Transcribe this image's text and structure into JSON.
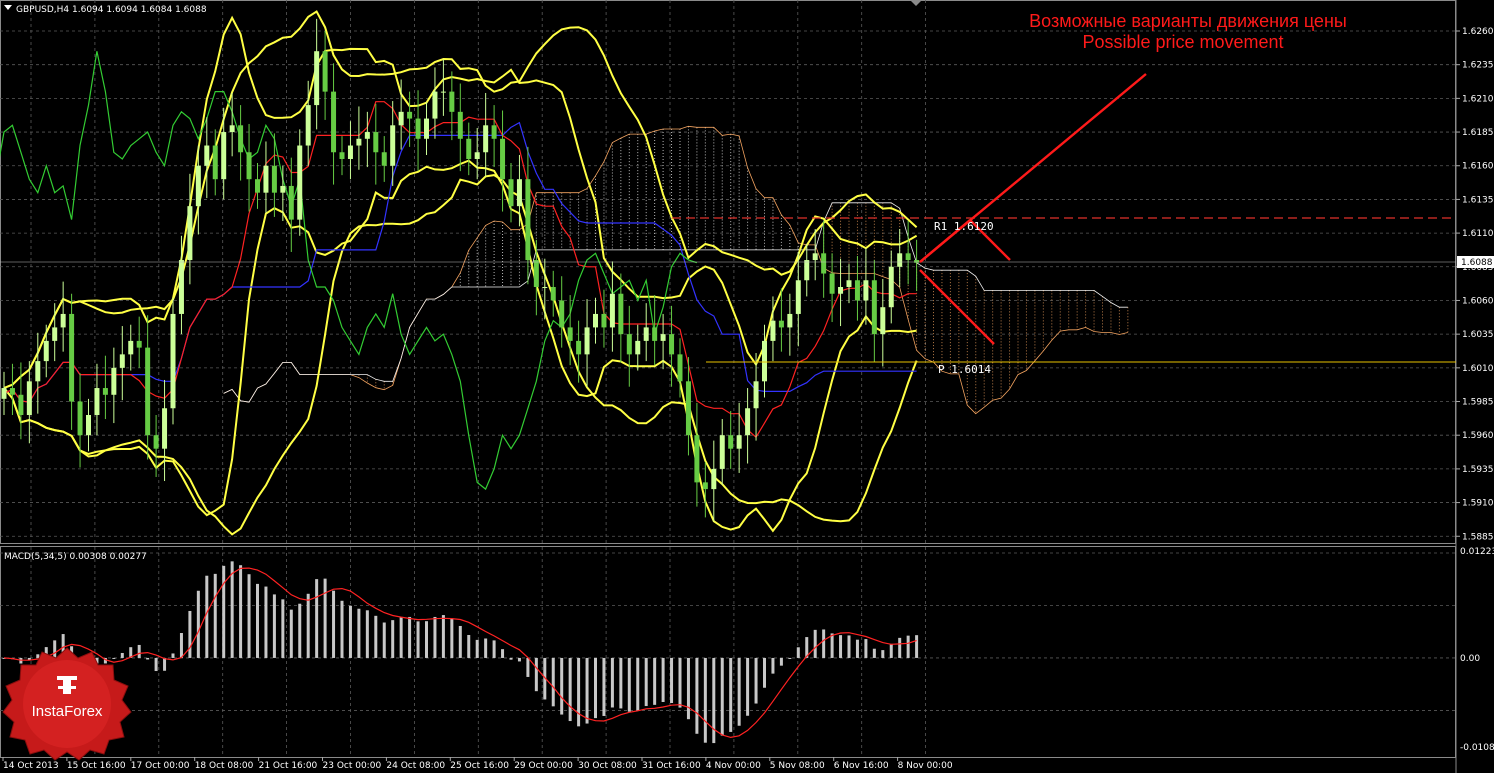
{
  "window": {
    "symbol_info": "GBPUSD,H4  1.6094 1.6094 1.6084 1.6088"
  },
  "annotation": {
    "title_ru": "Возможные варианты движения цены",
    "title_en": "Possible price movement",
    "r1_label": "R1  1.6120",
    "p_label": "P  1.6014",
    "current_price": "1.6088"
  },
  "price_axis": {
    "ticks": [
      "1.6260",
      "1.6235",
      "1.6210",
      "1.6185",
      "1.6160",
      "1.6135",
      "1.6110",
      "1.6085",
      "1.6060",
      "1.6035",
      "1.6010",
      "1.5985",
      "1.5960",
      "1.5935",
      "1.5910",
      "1.5885"
    ],
    "min": 1.588,
    "max": 1.6283
  },
  "macd_panel": {
    "title": "MACD(5,34,5) 0.00308 0.00277",
    "ticks": [
      "0.01223",
      "0.00",
      "-0.01087"
    ],
    "max": 0.01223,
    "min": -0.01087
  },
  "time_axis": {
    "labels": [
      "14 Oct 2013",
      "15 Oct 16:00",
      "17 Oct 00:00",
      "18 Oct 08:00",
      "21 Oct 16:00",
      "23 Oct 00:00",
      "24 Oct 08:00",
      "25 Oct 16:00",
      "29 Oct 00:00",
      "30 Oct 08:00",
      "31 Oct 16:00",
      "4 Nov 00:00",
      "5 Nov 08:00",
      "6 Nov 16:00",
      "8 Nov 00:00"
    ]
  },
  "logo": {
    "text": "InstaForex"
  },
  "colors": {
    "background": "#000000",
    "grid": "#5a5a5a",
    "bull_candle": "#ccff99",
    "bear_candle": "#66cc44",
    "bollinger": "#ffff44",
    "tenkan": "#ff2222",
    "kijun": "#3333ff",
    "chikou": "#33cc33",
    "cloud_bull": "#f2f2f2",
    "cloud_bear": "#f4a460",
    "forecast": "#ff1a1a",
    "pivot": "#e8c200",
    "macd_hist": "#c8c8c8",
    "macd_signal": "#ff2222"
  },
  "chart_data": {
    "type": "candlestick",
    "symbol": "GBPUSD",
    "timeframe": "H4",
    "close": [
      1.5995,
      1.599,
      1.5975,
      1.6,
      1.6015,
      1.603,
      1.604,
      1.605,
      1.5985,
      1.596,
      1.5975,
      1.5995,
      1.599,
      1.601,
      1.602,
      1.603,
      1.6025,
      1.596,
      1.595,
      1.598,
      1.605,
      1.609,
      1.613,
      1.616,
      1.6175,
      1.615,
      1.6185,
      1.619,
      1.617,
      1.615,
      1.614,
      1.616,
      1.614,
      1.6145,
      1.612,
      1.6175,
      1.6205,
      1.6245,
      1.6215,
      1.617,
      1.6165,
      1.6175,
      1.618,
      1.6185,
      1.617,
      1.616,
      1.619,
      1.62,
      1.6195,
      1.618,
      1.6195,
      1.6215,
      1.6215,
      1.62,
      1.618,
      1.6165,
      1.617,
      1.619,
      1.618,
      1.615,
      1.613,
      1.615,
      1.609,
      1.607,
      1.607,
      1.606,
      1.604,
      1.603,
      1.602,
      1.604,
      1.605,
      1.604,
      1.6065,
      1.6035,
      1.602,
      1.603,
      1.604,
      1.603,
      1.6035,
      1.602,
      1.6,
      1.596,
      1.5925,
      1.592,
      1.5935,
      1.596,
      1.595,
      1.596,
      1.598,
      1.6,
      1.603,
      1.6045,
      1.604,
      1.605,
      1.6075,
      1.609,
      1.6095,
      1.608,
      1.6065,
      1.607,
      1.6075,
      1.606,
      1.6075,
      1.6035,
      1.6055,
      1.6085,
      1.6095,
      1.609,
      1.6088
    ]
  }
}
